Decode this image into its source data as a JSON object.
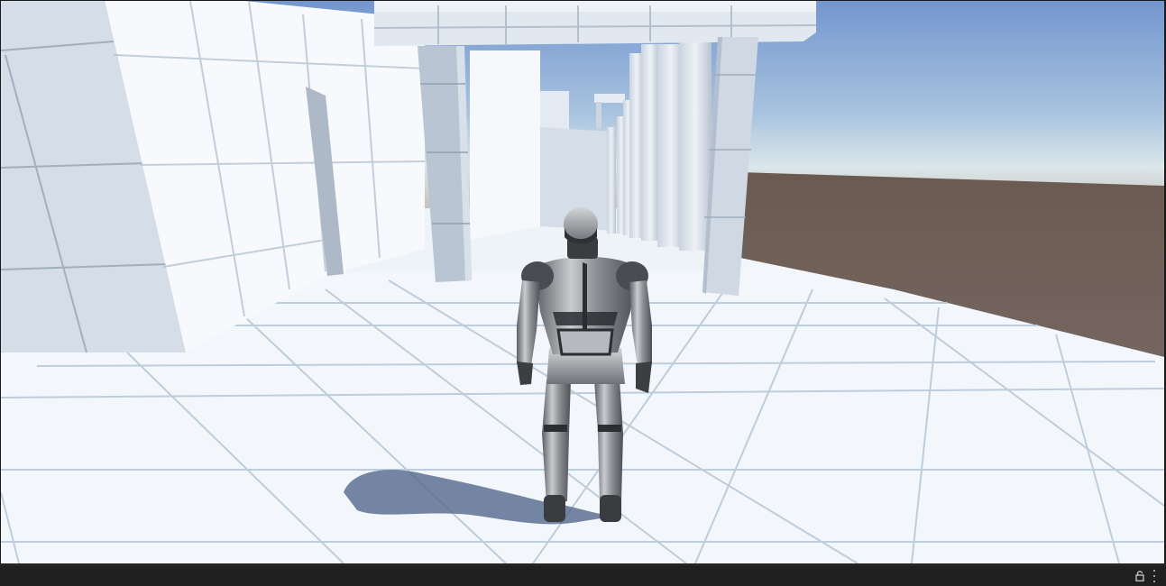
{
  "scene": {
    "sky_top_color": "#7a9fd4",
    "sky_horizon_color": "#dfe9ee",
    "ground_color": "#6b5c55",
    "floor_color": "#f4f7fb",
    "wall_color": "#dde6f0",
    "character_color": "#9a9ca1"
  },
  "toolbar": {
    "lock_icon": "lock-icon",
    "menu_icon": "kebab-menu-icon"
  }
}
